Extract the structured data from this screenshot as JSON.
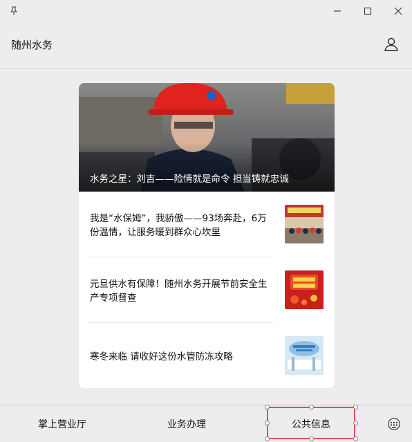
{
  "window": {
    "pin_icon": "pin-icon",
    "minimize_icon": "minimize-icon",
    "maximize_icon": "maximize-icon",
    "close_icon": "close-icon"
  },
  "header": {
    "title": "随州水务",
    "user_icon": "user-icon"
  },
  "hero": {
    "caption": "水务之星：刘吉——险情就是命令 担当铸就忠诚"
  },
  "news": [
    {
      "title": "我是“水保姆”，我骄傲——93场奔赴，6万份温情，让服务暖到群众心坎里"
    },
    {
      "title": "元旦供水有保障！随州水务开展节前安全生产专项督查"
    },
    {
      "title": "寒冬来临 请收好这份水管防冻攻略"
    }
  ],
  "tabs": [
    {
      "label": "掌上营业厅"
    },
    {
      "label": "业务办理"
    },
    {
      "label": "公共信息"
    }
  ],
  "keyboard_icon": "keyboard-icon",
  "colors": {
    "selection": "#e0505a",
    "background": "#ededed",
    "card": "#ffffff"
  }
}
